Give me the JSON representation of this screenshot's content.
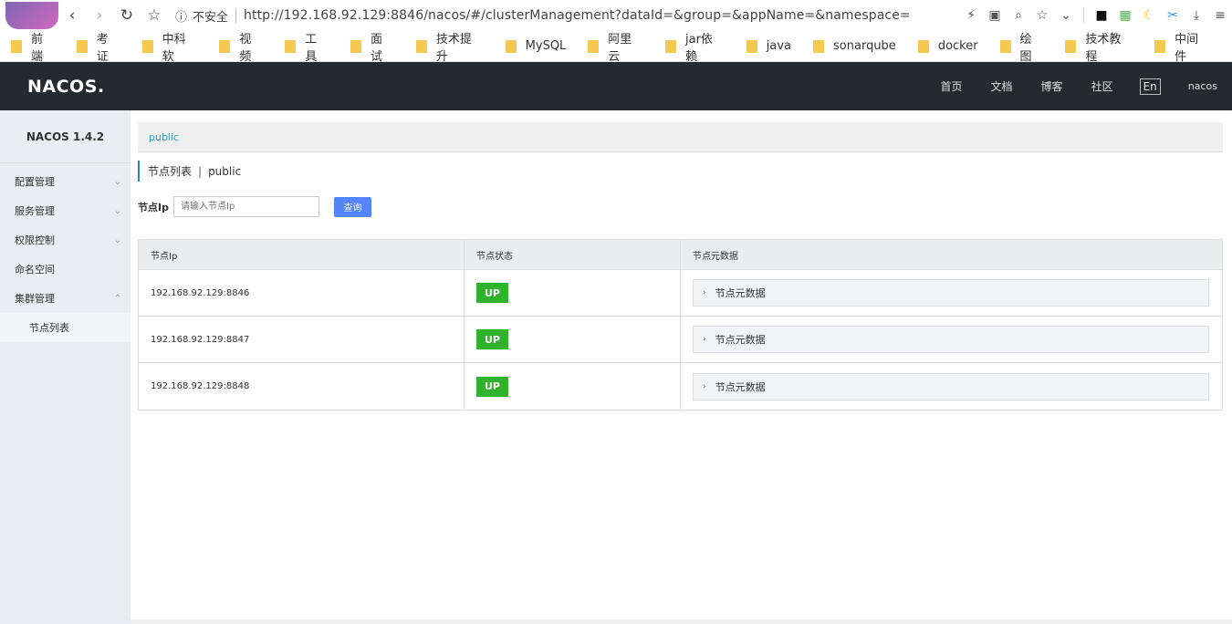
{
  "browser": {
    "security": "不安全",
    "url": "http://192.168.92.129:8846/nacos/#/clusterManagement?dataId=&group=&appName=&namespace="
  },
  "bookmarks": [
    "前端",
    "考证",
    "中科软",
    "视频",
    "工具",
    "面试",
    "技术提升",
    "MySQL",
    "阿里云",
    "jar依赖",
    "java",
    "sonarqube",
    "docker",
    "绘图",
    "技术教程",
    "中间件"
  ],
  "header": {
    "logo": "NACOS.",
    "nav": [
      "首页",
      "文档",
      "博客",
      "社区"
    ],
    "lang": "En",
    "user": "nacos"
  },
  "sidebar": {
    "title": "NACOS 1.4.2",
    "items": [
      {
        "label": "配置管理",
        "chevron": "⌄"
      },
      {
        "label": "服务管理",
        "chevron": "⌄"
      },
      {
        "label": "权限控制",
        "chevron": "⌄"
      },
      {
        "label": "命名空间",
        "chevron": ""
      },
      {
        "label": "集群管理",
        "chevron": "⌃"
      }
    ],
    "sub_item": "节点列表"
  },
  "main": {
    "namespace": "public",
    "title": "节点列表",
    "title_divider": "|",
    "title_ns": "public",
    "search_label": "节点Ip",
    "search_placeholder": "请输入节点Ip",
    "search_button": "查询",
    "columns": [
      "节点Ip",
      "节点状态",
      "节点元数据"
    ],
    "rows": [
      {
        "ip": "192.168.92.129:8846",
        "status": "UP",
        "meta": "节点元数据"
      },
      {
        "ip": "192.168.92.129:8847",
        "status": "UP",
        "meta": "节点元数据"
      },
      {
        "ip": "192.168.92.129:8848",
        "status": "UP",
        "meta": "节点元数据"
      }
    ]
  }
}
